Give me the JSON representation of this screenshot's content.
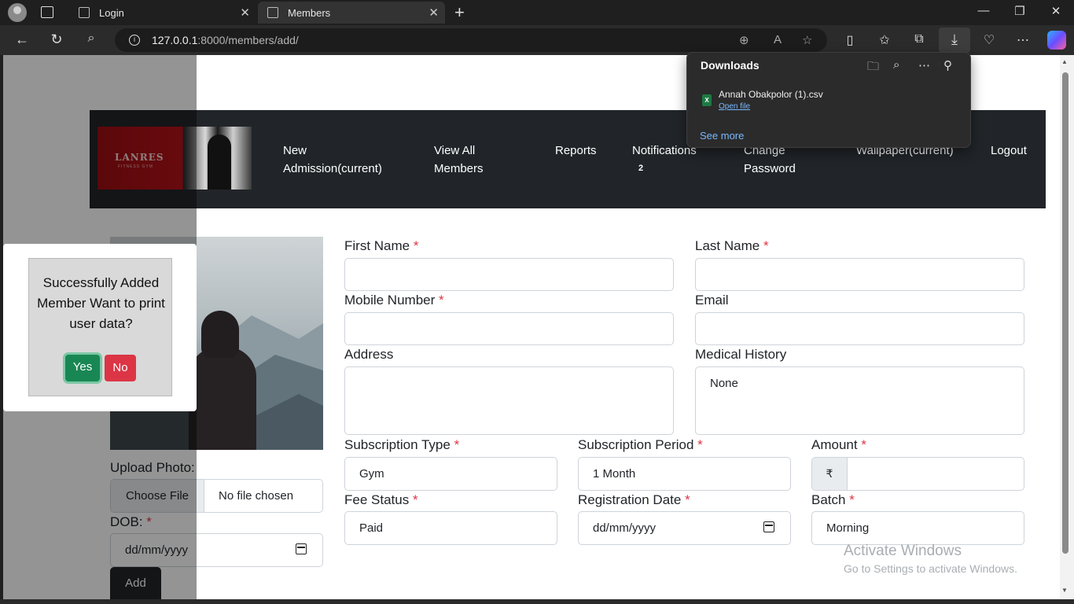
{
  "browser": {
    "tabs": [
      {
        "label": "Login",
        "active": false
      },
      {
        "label": "Members",
        "active": true
      }
    ],
    "url_host": "127.0.0.1",
    "url_rest": ":8000/members/add/"
  },
  "downloads": {
    "title": "Downloads",
    "file_name": "Annah Obakpolor (1).csv",
    "open_file": "Open file",
    "see_more": "See more",
    "file_badge": "X"
  },
  "nav": {
    "logo_text": "LANRES",
    "logo_sub": "FITNESS GYM",
    "links": [
      "New\nAdmission(current)",
      "View All\nMembers",
      "Reports",
      "Notifications",
      "Change\nPassword",
      "Wallpaper(current)",
      "Logout"
    ],
    "notifications_count": "2"
  },
  "form": {
    "first_name": "First Name",
    "last_name": "Last Name",
    "mobile": "Mobile Number",
    "email": "Email",
    "address": "Address",
    "medical_history": "Medical History",
    "medical_history_value": "None",
    "subscription_type": "Subscription Type",
    "subscription_type_value": "Gym",
    "subscription_period": "Subscription Period",
    "subscription_period_value": "1 Month",
    "amount": "Amount",
    "currency": "₹",
    "fee_status": "Fee Status",
    "fee_status_value": "Paid",
    "registration_date": "Registration Date",
    "registration_date_placeholder": "dd/mm/yyyy",
    "batch": "Batch",
    "batch_value": "Morning",
    "upload_photo": "Upload Photo:",
    "choose_file": "Choose File",
    "no_file": "No file chosen",
    "dob": "DOB:",
    "dob_placeholder": "dd/mm/yyyy",
    "add": "Add",
    "required_mark": "*"
  },
  "modal": {
    "message": "Successfully Added Member Want to print user data?",
    "yes": "Yes",
    "no": "No"
  },
  "watermark": {
    "title": "Activate Windows",
    "subtitle": "Go to Settings to activate Windows."
  },
  "colors": {
    "navbar": "#212529",
    "required": "#dc3545",
    "yes": "#198754",
    "no": "#dc3545"
  }
}
